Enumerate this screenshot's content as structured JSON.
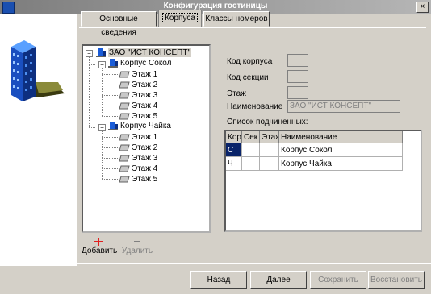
{
  "window": {
    "title": "Конфигурация гостиницы",
    "close_glyph": "×"
  },
  "tabs": [
    {
      "label": "Основные сведения",
      "active": false
    },
    {
      "label": "Корпуса",
      "active": true
    },
    {
      "label": "Классы номеров",
      "active": false
    }
  ],
  "tree": {
    "root": "ЗАО \"ИСТ КОНСЕПТ\"",
    "buildings": [
      {
        "label": "Корпус Сокол",
        "floors": [
          "Этаж 1",
          "Этаж 2",
          "Этаж 3",
          "Этаж 4",
          "Этаж 5"
        ]
      },
      {
        "label": "Корпус Чайка",
        "floors": [
          "Этаж 1",
          "Этаж 2",
          "Этаж 3",
          "Этаж 4",
          "Этаж 5"
        ]
      }
    ],
    "expander_glyph": "−"
  },
  "form": {
    "code_label": "Код корпуса",
    "section_label": "Код секции",
    "floor_label": "Этаж",
    "name_label": "Наименование",
    "name_value": "ЗАО \"ИСТ КОНСЕПТ\"",
    "code_value": "",
    "section_value": "",
    "floor_value": ""
  },
  "subordinates": {
    "label": "Список подчиненных:",
    "columns": [
      "Кор",
      "Сек",
      "Этаж",
      "Наименование"
    ],
    "rows": [
      [
        "С",
        "",
        "",
        "Корпус Сокол"
      ],
      [
        "Ч",
        "",
        "",
        "Корпус Чайка"
      ]
    ]
  },
  "toolbar": {
    "add_label": "Добавить",
    "delete_label": "Удалить"
  },
  "buttons": {
    "back": "Назад",
    "next": "Далее",
    "save": "Сохранить",
    "restore": "Восстановить"
  },
  "colors": {
    "selection": "#0a246a",
    "add_icon": "#e02020",
    "building": "#1a5cd8"
  }
}
